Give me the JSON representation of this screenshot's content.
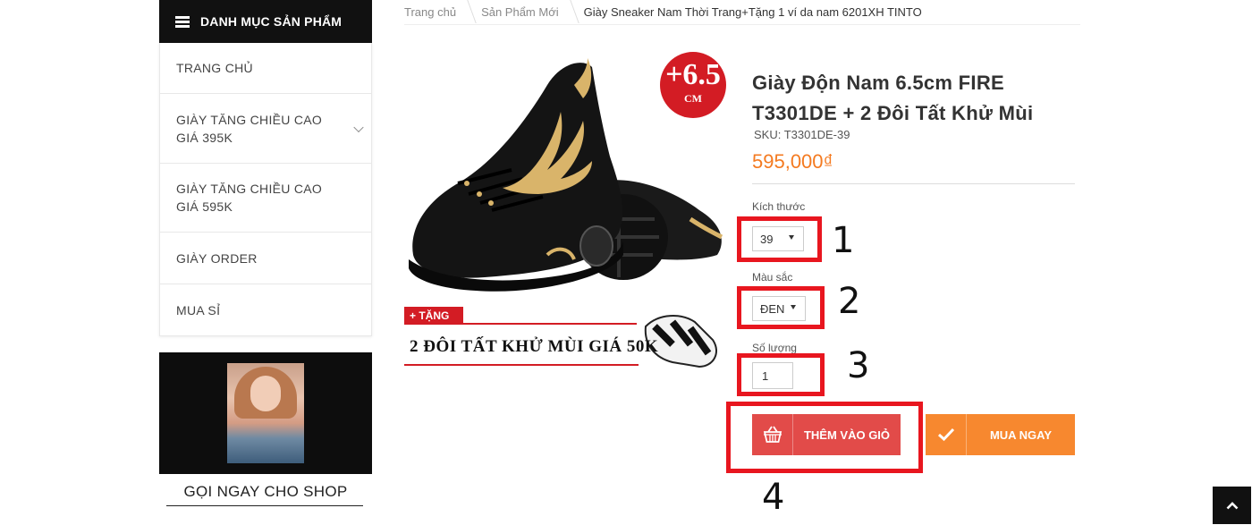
{
  "sidebar": {
    "header": "DANH MỤC SẢN PHẨM",
    "items": [
      {
        "label": "TRANG CHỦ"
      },
      {
        "label": "GIÀY TĂNG CHIỀU CAO GIÁ 395K"
      },
      {
        "label": "GIÀY TĂNG CHIỀU CAO GIÁ 595K"
      },
      {
        "label": "GIÀY ORDER"
      },
      {
        "label": "MUA SỈ"
      }
    ],
    "promo_caption": "GỌI NGAY CHO SHOP"
  },
  "breadcrumb": [
    "Trang chủ",
    "Sản Phẩm Mới",
    "Giày Sneaker Nam Thời Trang+Tặng 1 ví da nam 6201XH TINTO"
  ],
  "product_image": {
    "badge_big": "+6.5",
    "badge_small": "CM",
    "gift_tag": "+ TẶNG",
    "gift_text": "2 ĐÔI TẤT KHỬ MÙI GIÁ 50K"
  },
  "product": {
    "title": "Giày Độn Nam 6.5cm FIRE T3301DE + 2 Đôi Tất Khử Mùi",
    "sku": "SKU: T3301DE-39",
    "price": "595,000₫"
  },
  "options": {
    "size_label": "Kích thước",
    "size_value": "39",
    "color_label": "Màu sắc",
    "color_value": "ĐEN",
    "qty_label": "Số lượng",
    "qty_value": "1"
  },
  "buttons": {
    "add_to_cart": "THÊM VÀO GIỎ",
    "buy_now": "MUA NGAY"
  },
  "annotations": [
    "1",
    "2",
    "3",
    "4"
  ],
  "colors": {
    "accent_red": "#e24b49",
    "accent_orange": "#f7882f",
    "price": "#f47a20",
    "highlight": "#e8161f"
  }
}
